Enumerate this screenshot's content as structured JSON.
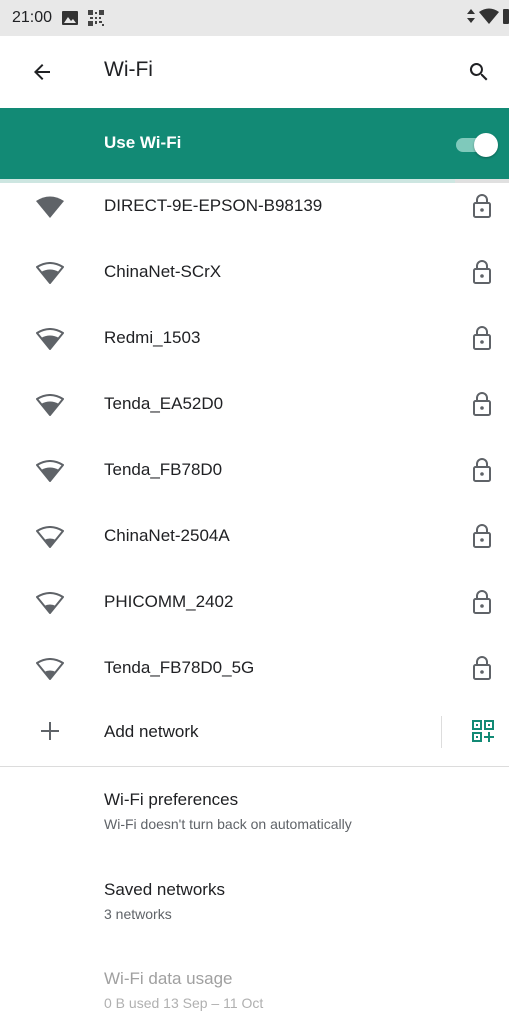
{
  "status_bar": {
    "time": "21:00",
    "icons": [
      "image-icon",
      "qr-icon",
      "signal-arrows-icon",
      "wifi-icon",
      "battery-icon"
    ]
  },
  "app_bar": {
    "title": "Wi-Fi",
    "back_icon": "arrow-back-icon",
    "search_icon": "search-icon"
  },
  "use_wifi": {
    "label": "Use Wi-Fi",
    "enabled": true,
    "accent_color": "#128a75"
  },
  "networks": [
    {
      "name": "DIRECT-9E-EPSON-B98139",
      "signal": "full",
      "secured": true
    },
    {
      "name": "ChinaNet-SCrX",
      "signal": "high",
      "secured": true
    },
    {
      "name": "Redmi_1503",
      "signal": "high",
      "secured": true
    },
    {
      "name": "Tenda_EA52D0",
      "signal": "high",
      "secured": true
    },
    {
      "name": "Tenda_FB78D0",
      "signal": "high",
      "secured": true
    },
    {
      "name": "ChinaNet-2504A",
      "signal": "medium",
      "secured": true
    },
    {
      "name": "PHICOMM_2402",
      "signal": "medium",
      "secured": true
    },
    {
      "name": "Tenda_FB78D0_5G",
      "signal": "medium",
      "secured": true
    }
  ],
  "add_network": {
    "label": "Add network",
    "qr_icon": "qr-scan-icon"
  },
  "preferences": [
    {
      "title": "Wi-Fi preferences",
      "subtitle": "Wi-Fi doesn't turn back on automatically",
      "enabled": true
    },
    {
      "title": "Saved networks",
      "subtitle": "3 networks",
      "enabled": true
    },
    {
      "title": "Wi-Fi data usage",
      "subtitle": "0 B used 13 Sep – 11 Oct",
      "enabled": false
    }
  ]
}
